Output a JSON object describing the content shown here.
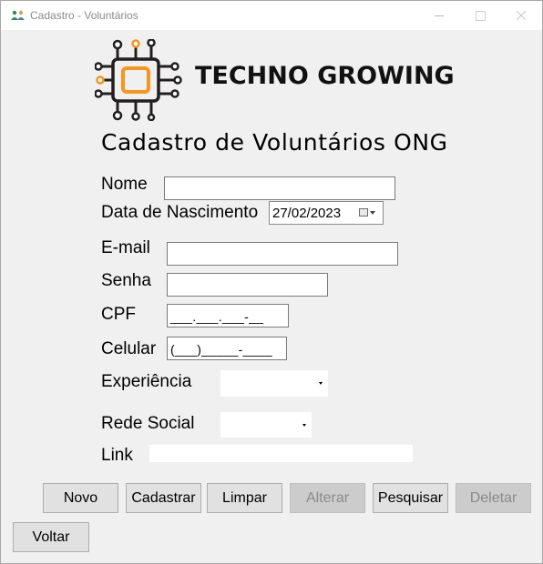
{
  "window": {
    "title": "Cadastro - Voluntários",
    "icon": "people-icon"
  },
  "logo": {
    "text": "TECHNO GROWING",
    "icon": "circuit-chip-icon",
    "colors": {
      "chip": "#f7941d",
      "lines": "#231f20"
    }
  },
  "heading": "Cadastro de Voluntários ONG",
  "form": {
    "nome_label": "Nome",
    "nome_value": "",
    "nascimento_label": "Data de Nascimento",
    "nascimento_value": "27/02/2023",
    "email_label": "E-mail",
    "email_value": "",
    "senha_label": "Senha",
    "senha_value": "",
    "cpf_label": "CPF",
    "cpf_mask": "___.___.___-__",
    "celular_label": "Celular",
    "celular_mask": "(___)_____-____",
    "experiencia_label": "Experiência",
    "experiencia_value": "",
    "rede_social_label": "Rede Social",
    "rede_social_value": "",
    "link_label": "Link",
    "link_value": ""
  },
  "buttons": {
    "novo": "Novo",
    "cadastrar": "Cadastrar",
    "limpar": "Limpar",
    "alterar": "Alterar",
    "pesquisar": "Pesquisar",
    "deletar": "Deletar",
    "voltar": "Voltar"
  }
}
